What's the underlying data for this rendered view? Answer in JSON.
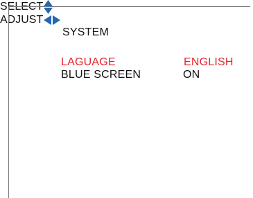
{
  "menu": {
    "title": "SYSTEM",
    "items": [
      {
        "label": "LAGUAGE",
        "value": "ENGLISH",
        "selected": true
      },
      {
        "label": "BLUE SCREEN",
        "value": "ON",
        "selected": false
      }
    ]
  },
  "footer": {
    "select_label": "SELECT",
    "select_icon": "up-down-arrow-icon",
    "adjust_label": "ADJUST",
    "adjust_icon": "left-right-arrow-icon"
  },
  "colors": {
    "highlight": "#e8262f",
    "text": "#111111",
    "icon": "#2467b2"
  }
}
